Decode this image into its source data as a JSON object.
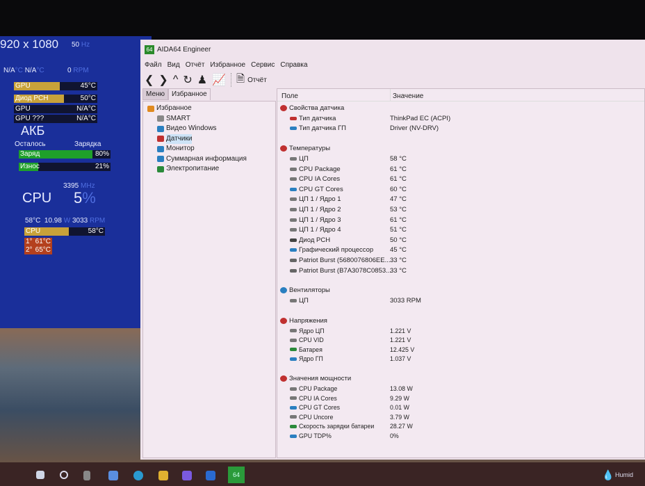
{
  "gadget": {
    "resolution": "920 x 1080",
    "refresh": "50",
    "refresh_unit": "Hz",
    "na1": "N/A",
    "na2": "N/A",
    "deg": "°C",
    "fan_top": "0",
    "rpm": "RPM",
    "bars": [
      {
        "label": "GPU",
        "value": "45°C",
        "fill": 0.55,
        "color": "#c8a23a"
      },
      {
        "label": "Диод PCH",
        "value": "50°C",
        "fill": 0.6,
        "color": "#c8a23a"
      },
      {
        "label": "GPU",
        "value": "N/A°C",
        "fill": 0,
        "color": "#c8a23a"
      },
      {
        "label": "GPU ???",
        "value": "N/A°C",
        "fill": 0,
        "color": "#c8a23a"
      }
    ],
    "battery_title": "АКБ",
    "remaining": "Осталось",
    "charging": "Зарядка",
    "charge": {
      "label": "Заряд",
      "value": "80%",
      "fill": 0.8
    },
    "wear": {
      "label": "Износ",
      "value": "21%",
      "fill": 0.21
    },
    "cpu_mhz": "3395",
    "mhz": "MHz",
    "cpu_label": "CPU",
    "cpu_load": "5",
    "pct": "%",
    "cpu_temp": "58°C",
    "cpu_power": "10.98",
    "w": "W",
    "cpu_fan": "3033",
    "cpu_bar": {
      "label": "CPU",
      "value": "58°C",
      "fill": 0.58
    },
    "core1": {
      "label": "1°",
      "value": "61°C"
    },
    "core2": {
      "label": "2°",
      "value": "65°C"
    }
  },
  "window": {
    "title": "AIDA64 Engineer",
    "logo": "64",
    "menu": [
      "Файл",
      "Вид",
      "Отчёт",
      "Избранное",
      "Сервис",
      "Справка"
    ],
    "report": "Отчёт",
    "tabs": [
      "Меню",
      "Избранное"
    ],
    "tree": [
      {
        "label": "Избранное",
        "color": "#e08a20"
      },
      {
        "label": "SMART",
        "color": "#888"
      },
      {
        "label": "Видео Windows",
        "color": "#2a7fc0"
      },
      {
        "label": "Датчики",
        "color": "#c03030",
        "selected": true
      },
      {
        "label": "Монитор",
        "color": "#2a7fc0"
      },
      {
        "label": "Суммарная информация",
        "color": "#2a7fc0"
      },
      {
        "label": "Электропитание",
        "color": "#2a8a3a"
      }
    ],
    "col_field": "Поле",
    "col_value": "Значение",
    "groups": [
      {
        "title": "Свойства датчика",
        "color": "#c03030",
        "rows": [
          [
            "Тип датчика",
            "ThinkPad EC  (ACPI)",
            "#c03030"
          ],
          [
            "Тип датчика ГП",
            "Driver  (NV-DRV)",
            "#2a7fc0"
          ]
        ]
      },
      {
        "title": "Температуры",
        "color": "#c03030",
        "rows": [
          [
            "ЦП",
            "58 °C",
            "#777"
          ],
          [
            "CPU Package",
            "61 °C",
            "#777"
          ],
          [
            "CPU IA Cores",
            "61 °C",
            "#777"
          ],
          [
            "CPU GT Cores",
            "60 °C",
            "#2a7fc0"
          ],
          [
            "ЦП 1 / Ядро 1",
            "47 °C",
            "#777"
          ],
          [
            "ЦП 1 / Ядро 2",
            "53 °C",
            "#777"
          ],
          [
            "ЦП 1 / Ядро 3",
            "61 °C",
            "#777"
          ],
          [
            "ЦП 1 / Ядро 4",
            "51 °C",
            "#777"
          ],
          [
            "Диод PCH",
            "50 °C",
            "#444"
          ],
          [
            "Графический процессор",
            "45 °C",
            "#2a7fc0"
          ],
          [
            "Patriot Burst (5680076806EE...",
            "33 °C",
            "#666"
          ],
          [
            "Patriot Burst (B7A3078C0853...",
            "33 °C",
            "#666"
          ]
        ]
      },
      {
        "title": "Вентиляторы",
        "color": "#2a7fc0",
        "rows": [
          [
            "ЦП",
            "3033 RPM",
            "#777"
          ]
        ]
      },
      {
        "title": "Напряжения",
        "color": "#c03030",
        "rows": [
          [
            "Ядро ЦП",
            "1.221 V",
            "#777"
          ],
          [
            "CPU VID",
            "1.221 V",
            "#777"
          ],
          [
            "Батарея",
            "12.425 V",
            "#2a8a3a"
          ],
          [
            "Ядро ГП",
            "1.037 V",
            "#2a7fc0"
          ]
        ]
      },
      {
        "title": "Значения мощности",
        "color": "#c03030",
        "rows": [
          [
            "CPU Package",
            "13.08 W",
            "#777"
          ],
          [
            "CPU IA Cores",
            "9.29 W",
            "#777"
          ],
          [
            "CPU GT Cores",
            "0.01 W",
            "#2a7fc0"
          ],
          [
            "CPU Uncore",
            "3.79 W",
            "#777"
          ],
          [
            "Скорость зарядки батареи",
            "28.27 W",
            "#2a8a3a"
          ],
          [
            "GPU TDP%",
            "0%",
            "#2a7fc0"
          ]
        ]
      }
    ]
  },
  "taskbar": {
    "aida_label": "64",
    "weather": "Humid"
  }
}
